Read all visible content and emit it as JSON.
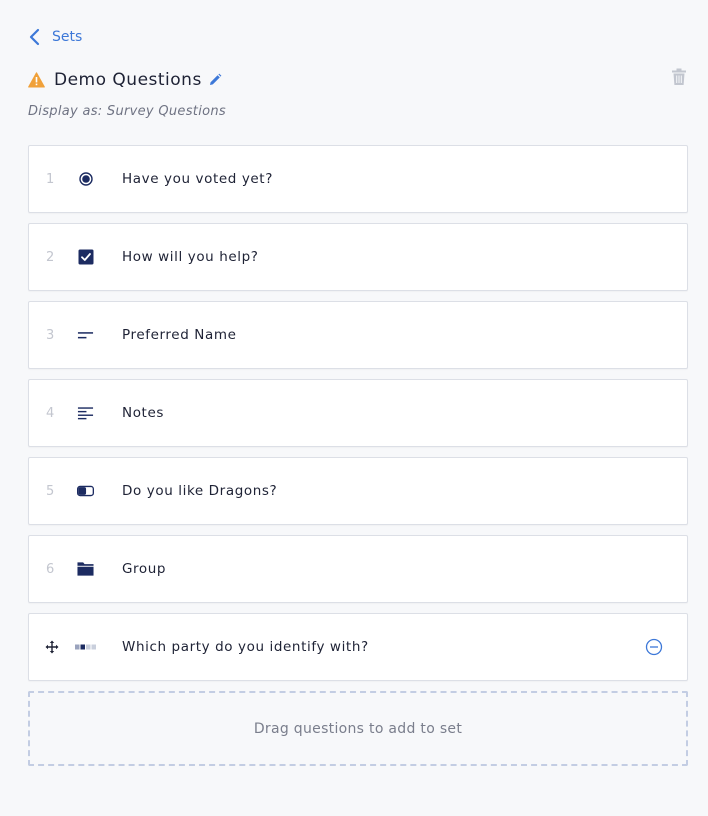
{
  "nav": {
    "back_label": "Sets"
  },
  "header": {
    "title": "Demo Questions",
    "subtitle": "Display as: Survey Questions"
  },
  "questions": [
    {
      "number": "1",
      "icon": "radio-button-icon",
      "label": "Have you voted yet?"
    },
    {
      "number": "2",
      "icon": "checkbox-icon",
      "label": "How will you help?"
    },
    {
      "number": "3",
      "icon": "short-text-icon",
      "label": "Preferred Name"
    },
    {
      "number": "4",
      "icon": "long-text-icon",
      "label": "Notes"
    },
    {
      "number": "5",
      "icon": "toggle-icon",
      "label": "Do you like Dragons?"
    },
    {
      "number": "6",
      "icon": "folder-icon",
      "label": "Group"
    },
    {
      "number": "",
      "icon": "segmented-choice-icon",
      "label": "Which party do you identify with?"
    }
  ],
  "dropzone": {
    "label": "Drag questions to add to set"
  },
  "colors": {
    "accent": "#3d78d8",
    "warning": "#f0a13a",
    "icon_dark": "#1c2b61",
    "icon_light": "#c9cfdc"
  }
}
